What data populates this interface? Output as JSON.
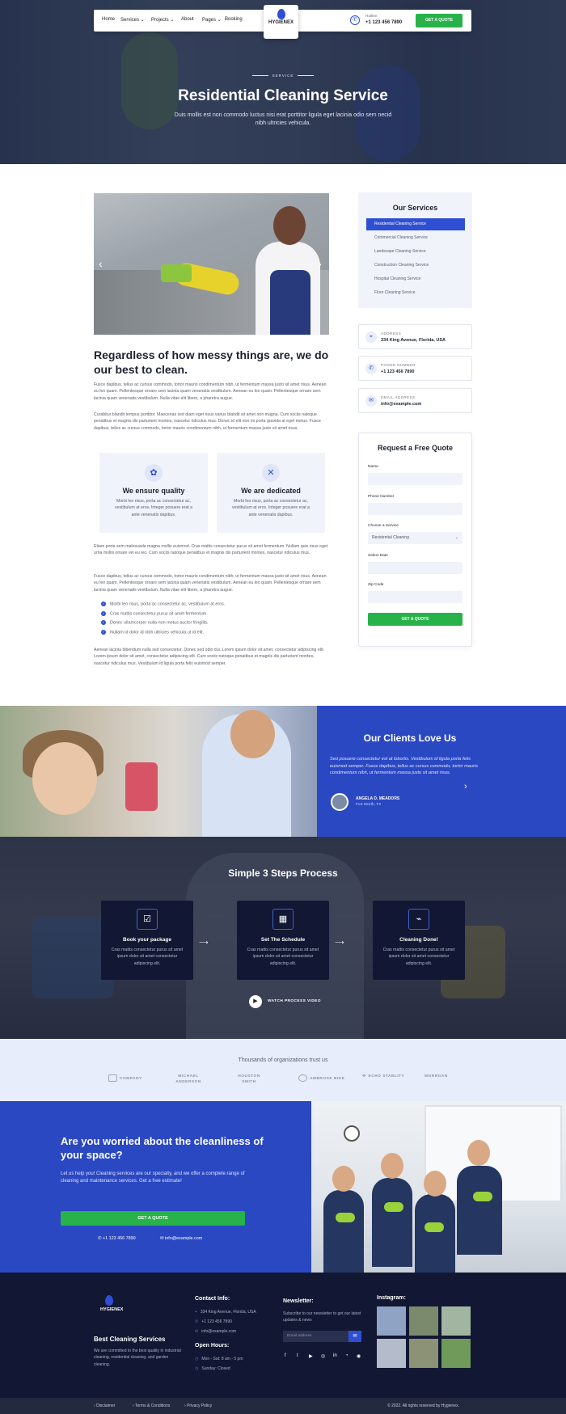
{
  "header": {
    "nav": [
      "Home",
      "Services ⌄",
      "Projects ⌄",
      "About",
      "Pages ⌄",
      "Booking"
    ],
    "logo": "HYGIENEX",
    "call_label": "Hotline:",
    "call_number": "+1 123 456 7890",
    "quote_button": "GET A QUOTE"
  },
  "hero": {
    "tag": "SERVICE",
    "title": "Residential Cleaning Service",
    "subtitle": "Duis mollis est non commodo luctus nisi erat porttitor ligula eget lacinia odio sem necid nibh ultricies vehicula."
  },
  "main": {
    "title": "Regardless of how messy things are, we do our best to clean.",
    "para1": "Fusce dapibus, tellus ac cursus commodo, tortor mauris condimentum nibh, ut fermentum massa justo sit amet risus. Aenean eu leo quam. Pellentesque ornare sem lacinia quam venenatis vestibulum. Aenean eu leo quam. Pellentesque ornare sem lacinia quam venenatis vestibulum. Nulla vitae elit libero, a pharetra augue.",
    "para2": "Curabitur blandit tempus porttitor. Maecenas sed diam eget risus varius blandit sit amet non magna. Cum sociis natoque penatibus et magnis dis parturient montes, nascetur ridiculus mus. Donec id elit non mi porta gravida at eget metus. Fusce dapibus, tellus ac cursus commodo, tortor mauris condimentum nibh, ut fermentum massa justo sit amet risus.",
    "features": [
      {
        "icon": "✿",
        "title": "We ensure quality",
        "desc": "Morbi leo risus, porta ac consectetur ac, vestibulum at eros. Integer posuere erat a ante venenatis dapibus."
      },
      {
        "icon": "✕",
        "title": "We are dedicated",
        "desc": "Morbi leo risus, porta ac consectetur ac, vestibulum at eros. Integer posuere erat a ante venenatis dapibus."
      }
    ],
    "para3": "Etiam porta sem malesuada magna mollis euismod. Cras mattis consectetur purus sit amet fermentum. Nullam quis risus eget urna mollis ornare vel eu leo. Cum sociis natoque penatibus et magnis dis parturient montes, nascetur ridiculus mus.",
    "para4": "Fusce dapibus, tellus ac cursus commodo, tortor mauris condimentum nibh, ut fermentum massa justo sit amet risus. Aenean eu leo quam. Pellentesque ornare sem lacinia quam venenatis vestibulum. Aenean eu leo quam. Pellentesque ornare sem lacinia quam venenatis vestibulum. Nulla vitae elit libero, a pharetra augue.",
    "checks": [
      "Morbi leo risus, porta ac consectetur ac, vestibulum at eros.",
      "Cras mattis consectetur purus sit amet fermentum.",
      "Donec ullamcorper nulla non metus auctor fringilla.",
      "Nullam id dolor id nibh ultricies vehicula ut id elit."
    ],
    "para5": "Aenean lacinia bibendum nulla sed consectetur. Donec sed odio dui. Lorem ipsum dolor sit amet, consectetur adipiscing elit. Lorem ipsum dolor sit amet, consectetur adipiscing elit. Cum sociis natoque penatibus et magnis dis parturient montes, nascetur ridiculus mus. Vestibulum id ligula porta felis euismod semper."
  },
  "sidebar": {
    "services_title": "Our Services",
    "services": [
      "Residential Cleaning Service",
      "Commercial Cleaning Service",
      "Landscape Cleaning Service",
      "Construction Cleaning Service",
      "Hospital Cleaning Service",
      "Floor Cleaning Service"
    ],
    "info": [
      {
        "label": "ADDRESS",
        "value": "334 King Avenue, Florida, USA",
        "icon": "map-pin"
      },
      {
        "label": "PHONE NUMBER",
        "value": "+1 123 456 7890",
        "icon": "phone"
      },
      {
        "label": "EMAIL ADDRESS",
        "value": "info@example.com",
        "icon": "envelope"
      }
    ],
    "form": {
      "title": "Request a Free Quote",
      "name_label": "Name",
      "phone_label": "Phone Number",
      "service_label": "Choose a Service",
      "service_value": "Residential Cleaning",
      "date_label": "Select Date",
      "zip_label": "Zip Code",
      "button": "GET A QUOTE"
    }
  },
  "testimonial": {
    "title": "Our Clients Love Us",
    "quote": "Sed posuere consectetur est at lobortis. Vestibulum id ligula porta felis euismod semper. Fusce dapibus, tellus ac cursus commodo, tortor mauris condimentum nibh, ut fermentum massa justo sit amet risus.",
    "name": "ANGELA D. MEADORS",
    "location": "Fort Worth, TX"
  },
  "steps": {
    "title": "Simple 3 Steps Process",
    "items": [
      {
        "title": "Book your package",
        "desc": "Cras mattis consectetur purus sit amet ipsum dolor sit amet consectetur adipiscing elit."
      },
      {
        "title": "Set The Schedule",
        "desc": "Cras mattis consectetur purus sit amet ipsum dolor sit amet consectetur adipiscing elit."
      },
      {
        "title": "Cleaning Done!",
        "desc": "Cras mattis consectetur purus sit amet ipsum dolor sit amet consectetur adipiscing elit."
      }
    ],
    "video_label": "WATCH PROCESS VIDEO"
  },
  "trust": {
    "title": "Thousands of organizations trust us",
    "brands": [
      "COMPANY",
      "MICHAEL ANDERSON",
      "HOUSTON SMITH",
      "AMBROSE BIKE",
      "ECHO STABLITY",
      "MORRGAN"
    ]
  },
  "cta": {
    "title": "Are you worried about the cleanliness of your space?",
    "text": "Let us help you! Cleaning services are our specialty, and we offer a complete range of cleaning and maintenance services. Get a free estimate!",
    "button": "GET A QUOTE",
    "phone": "+1 123 456 7890",
    "email": "info@example.com"
  },
  "footer": {
    "logo": "HYGIENEX",
    "tagline": "Best Cleaning Services",
    "desc": "We are committed to the best quality in industrial cleaning, residential cleaning, and garden cleaning.",
    "contact_title": "Contact Info:",
    "address": "334 King Avenue, Florida, USA",
    "phone": "+1 123 456 7890",
    "email": "info@example.com",
    "hours_title": "Open Hours:",
    "hours": "Mon - Sat: 8 am - 5 pm",
    "sunday": "Sunday: Closed",
    "newsletter_title": "Newsletter:",
    "newsletter_text": "Subscribe to our newsletter to get our latest updates & news",
    "newsletter_placeholder": "Email address",
    "instagram_title": "Instagram:",
    "bottom_links": [
      "Disclaimer",
      "Terms & Conditions",
      "Privacy Policy"
    ],
    "copyright": "© 2022. All rights reserved by Hygienex."
  },
  "colors": {
    "brand_blue": "#2f4fd2",
    "brand_green": "#27b24a",
    "dark": "#121833"
  }
}
